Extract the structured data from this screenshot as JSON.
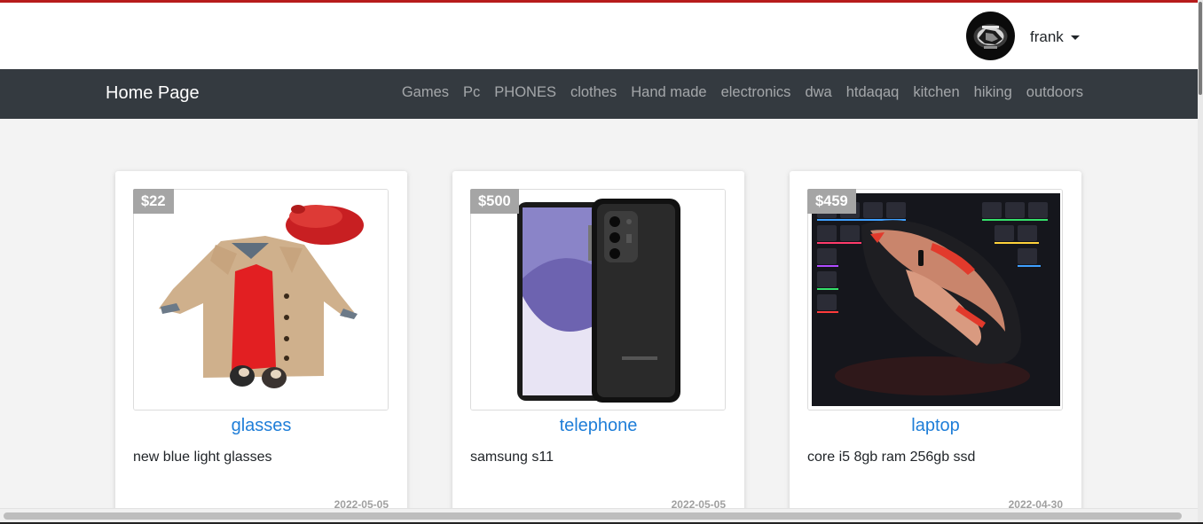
{
  "user": {
    "name": "frank",
    "avatar_icon": "avatar-image"
  },
  "navbar": {
    "brand": "Home Page",
    "links": [
      "Games",
      "Pc",
      "PHONES",
      "clothes",
      "Hand made",
      "electronics",
      "dwa",
      "htdaqaq",
      "kitchen",
      "hiking",
      "outdoors"
    ]
  },
  "products": [
    {
      "price": "$22",
      "title": "glasses",
      "description": "new blue light glasses",
      "date": "2022-05-05",
      "image": "kids-coat-outfit-image"
    },
    {
      "price": "$500",
      "title": "telephone",
      "description": "samsung s11",
      "date": "2022-05-05",
      "image": "samsung-phone-image"
    },
    {
      "price": "$459",
      "title": "laptop",
      "description": "core i5 8gb ram 256gb ssd",
      "date": "2022-04-30",
      "image": "gaming-mouse-keyboard-image"
    }
  ],
  "colors": {
    "navbar_bg": "#343a40",
    "link_blue": "#1f7ed8",
    "price_badge": "#a5a5a5",
    "accent_top": "#b71c1c"
  }
}
